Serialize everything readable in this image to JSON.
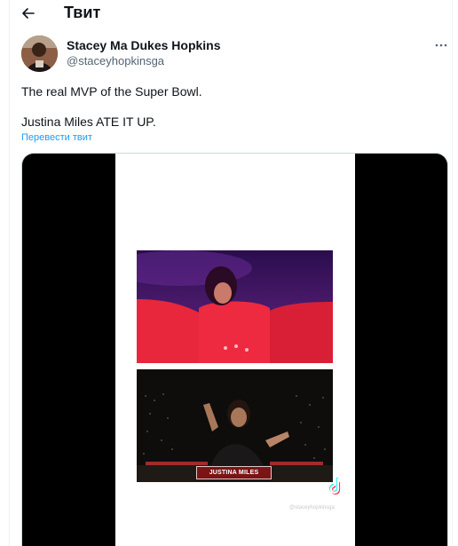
{
  "header": {
    "title": "Твит"
  },
  "author": {
    "name": "Stacey Ma Dukes Hopkins",
    "handle": "@staceyhopkinsga"
  },
  "tweet": {
    "line1": "The real MVP of the Super Bowl.",
    "line2": "Justina Miles ATE IT UP.",
    "translate_label": "Перевести твит"
  },
  "media": {
    "caption": "JUSTINA MILES",
    "watermark_handle": "@staceyhopkinsga"
  },
  "icons": [
    "back-arrow-icon",
    "more-icon",
    "tiktok-icon"
  ]
}
